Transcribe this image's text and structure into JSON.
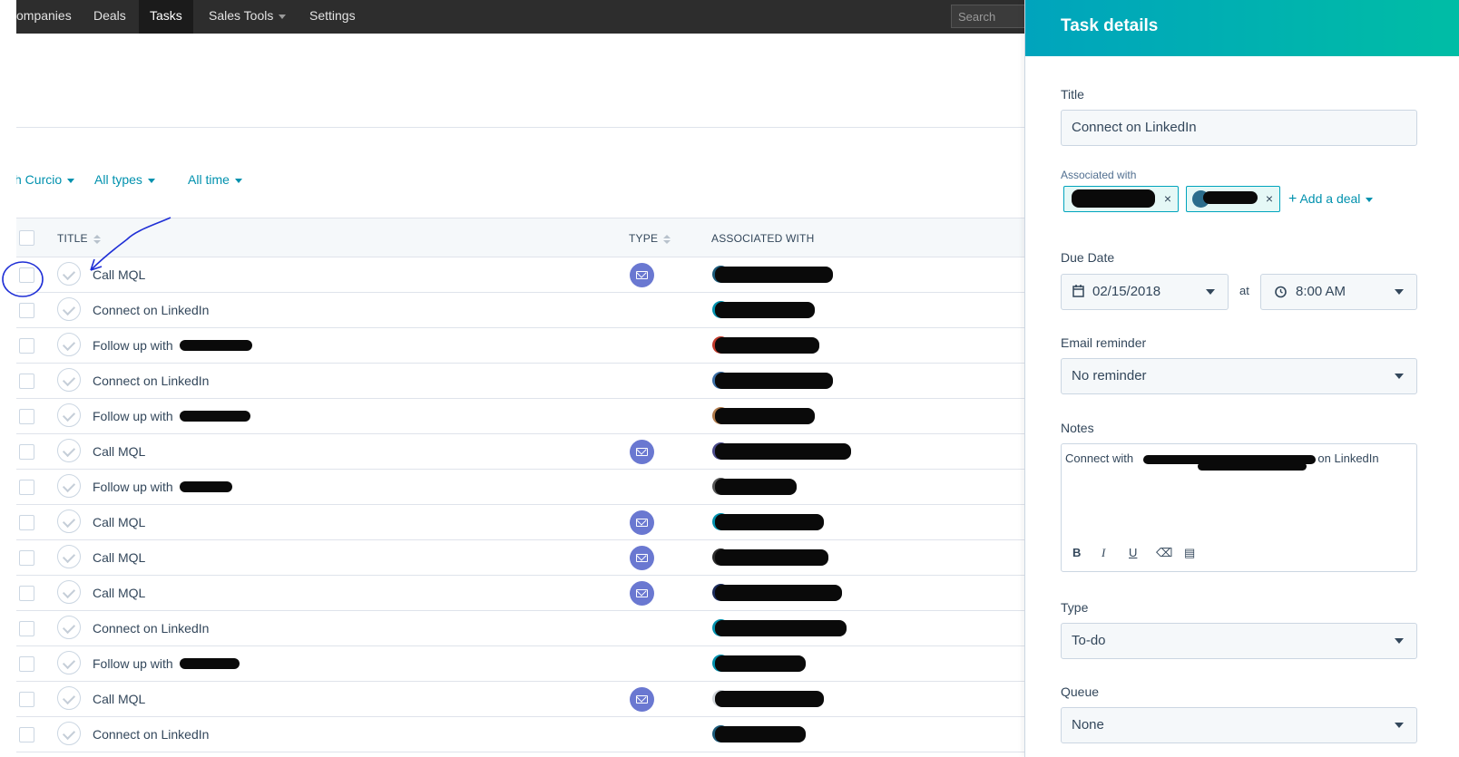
{
  "nav": {
    "items": [
      "ompanies",
      "Deals",
      "Tasks",
      "Sales Tools",
      "Settings"
    ],
    "active": "Tasks",
    "search_placeholder": "Search"
  },
  "filters": {
    "owner": "h Curcio",
    "types": "All types",
    "time": "All time"
  },
  "table": {
    "headers": {
      "title": "TITLE",
      "type": "TYPE",
      "associated": "ASSOCIATED WITH"
    },
    "rows": [
      {
        "title": "Call MQL",
        "type": "email"
      },
      {
        "title": "Connect on LinkedIn",
        "type": ""
      },
      {
        "title": "Follow up with",
        "type": ""
      },
      {
        "title": "Connect on LinkedIn",
        "type": ""
      },
      {
        "title": "Follow up with",
        "type": ""
      },
      {
        "title": "Call MQL",
        "type": "email"
      },
      {
        "title": "Follow up with",
        "type": ""
      },
      {
        "title": "Call MQL",
        "type": "email"
      },
      {
        "title": "Call MQL",
        "type": "email"
      },
      {
        "title": "Call MQL",
        "type": "email"
      },
      {
        "title": "Connect on LinkedIn",
        "type": ""
      },
      {
        "title": "Follow up with",
        "type": ""
      },
      {
        "title": "Call MQL",
        "type": "email"
      },
      {
        "title": "Connect on LinkedIn",
        "type": ""
      }
    ]
  },
  "panel": {
    "header": "Task details",
    "title_label": "Title",
    "title_value": "Connect on LinkedIn",
    "associated_label": "Associated with",
    "add_deal": "Add a deal",
    "due_label": "Due Date",
    "due_date": "02/15/2018",
    "at": "at",
    "due_time": "8:00 AM",
    "email_label": "Email reminder",
    "email_value": "No reminder",
    "notes_label": "Notes",
    "notes_prefix": "Connect with",
    "notes_suffix": "on LinkedIn",
    "type_label": "Type",
    "type_value": "To-do",
    "queue_label": "Queue",
    "queue_value": "None"
  },
  "colors": {
    "accent": "#0091ae",
    "header_gradient_start": "#00a4bd",
    "header_gradient_end": "#00bda5",
    "email_icon": "#6a78d1",
    "annotation": "#1f2fd6"
  }
}
